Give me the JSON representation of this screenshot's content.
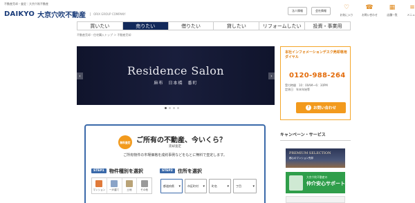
{
  "header": {
    "topline": "不動産売却・査定｜大京穴吹不動産",
    "logo_mark": "DAIKYO",
    "logo_name": "大京穴吹不動産",
    "logo_sub": "ORIX GROUP COMPANY",
    "btn_corporate": "法人情報",
    "btn_company": "会社情報",
    "icons": [
      {
        "name": "favorite-icon",
        "glyph": "♡",
        "label": "お気に入り"
      },
      {
        "name": "phone-icon",
        "glyph": "☎",
        "label": "お問い合わせ"
      },
      {
        "name": "store-icon",
        "glyph": "▦",
        "label": "店舗一覧"
      },
      {
        "name": "menu-icon",
        "glyph": "≡",
        "label": "メニュー"
      }
    ]
  },
  "gnav": [
    {
      "label": "買いたい",
      "active": false
    },
    {
      "label": "売りたい",
      "active": true
    },
    {
      "label": "借りたい",
      "active": false
    },
    {
      "label": "貸したい",
      "active": false
    },
    {
      "label": "リフォームしたい",
      "active": false
    },
    {
      "label": "投資・事業用",
      "active": false
    }
  ],
  "breadcrumb": "不動産売却・住宅購入トップ ＞ 不動産売却",
  "hero": {
    "title": "Residence Salon",
    "subtitle": "麻布　日本橋　番町",
    "prev": "‹",
    "next": "›"
  },
  "side": {
    "title": "本社インフォメーションデスク売却専用ダイヤル",
    "phone": "0120-988-264",
    "hours": "受付時間　10：00AM〜6：30PM",
    "holiday": "定休日　年末年始等",
    "button": "お問い合わせ",
    "button_icon": "?"
  },
  "campaign": {
    "heading": "キャンペーン・サービス",
    "banner1_title": "PREMIUM SELECTION",
    "banner1_sub": "都心のマンション売却",
    "banner2_small": "大京穴吹不動産の",
    "banner2_main": "仲介安心サポート"
  },
  "form": {
    "badge": "無料査定",
    "title": "ご所有の不動産、今いくら？",
    "subtitle": "売却査定",
    "desc": "ご所有物件の市場価格を成約事例などをもとに無料で査定します。",
    "step1_tag": "STEP1",
    "step1_label": "物件種別を選択",
    "step2_tag": "STEP2",
    "step2_label": "住所を選択",
    "types": [
      {
        "label": "マンション",
        "color": "#e07a3a"
      },
      {
        "label": "一戸建て",
        "color": "#8aa4c8"
      },
      {
        "label": "土地",
        "color": "#b9a377"
      },
      {
        "label": "その他",
        "color": "#9a9a9a"
      }
    ],
    "selects": [
      {
        "label": "都道府県",
        "highlight": true
      },
      {
        "label": "市区町村",
        "highlight": false
      },
      {
        "label": "町名",
        "highlight": false
      },
      {
        "label": "丁目",
        "highlight": false
      }
    ]
  }
}
